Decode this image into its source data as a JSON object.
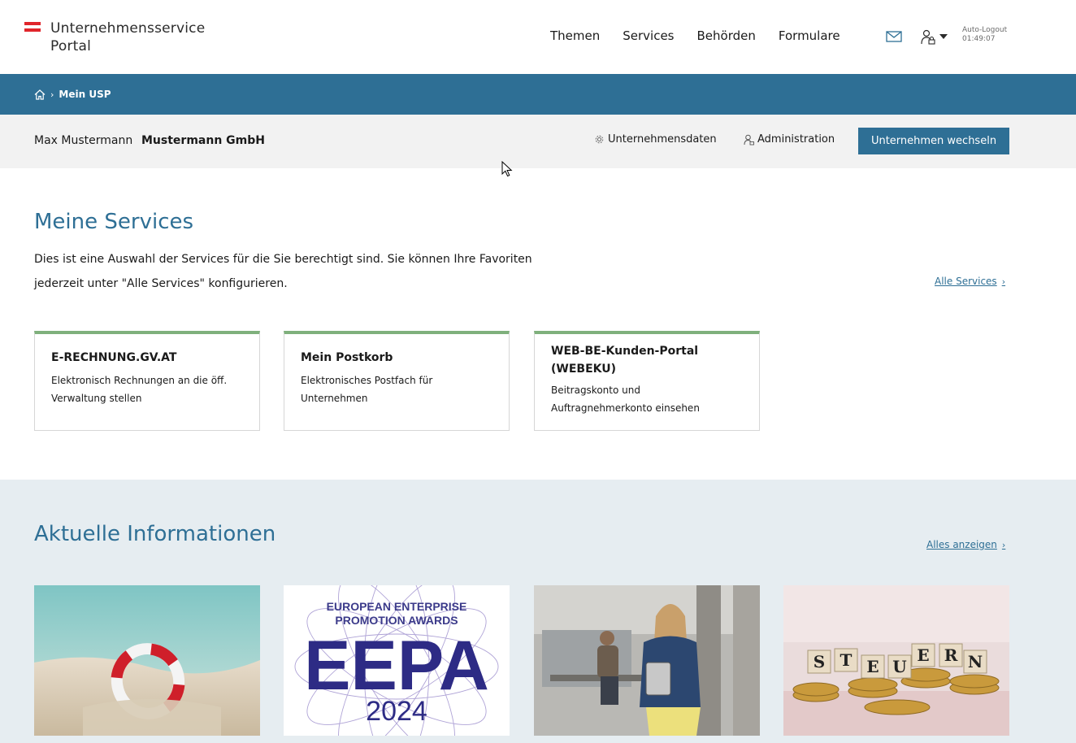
{
  "header": {
    "logo_line1": "Unternehmensservice",
    "logo_line2": "Portal",
    "nav": [
      "Themen",
      "Services",
      "Behörden",
      "Formulare"
    ],
    "mail_icon": "mail-icon",
    "user_icon": "user-lock-icon",
    "logout_label": "Auto-Logout",
    "logout_time": "01:49:07",
    "flag_colors": [
      "#e0252b",
      "#ffffff",
      "#e0252b"
    ]
  },
  "breadcrumb": {
    "home_icon": "home-icon",
    "current": "Mein USP"
  },
  "account": {
    "user": "Max Mustermann",
    "company": "Mustermann GmbH",
    "company_data_label": "Unternehmensdaten",
    "admin_label": "Administration",
    "switch_button": "Unternehmen wechseln"
  },
  "services": {
    "title": "Meine Services",
    "description": "Dies ist eine Auswahl der Services für die Sie berechtigt sind. Sie können Ihre Favoriten jederzeit unter \"Alle Services\" konfigurieren.",
    "all_link": "Alle Services",
    "cards": [
      {
        "title": "E-RECHNUNG.GV.AT",
        "desc": "Elektronisch Rechnungen an die öff. Verwaltung stellen"
      },
      {
        "title": "Mein Postkorb",
        "desc": "Elektronisches Postfach für Unternehmen"
      },
      {
        "title": "WEB-BE-Kunden-Portal (WEBEKU)",
        "desc": "Beitragskonto und Auftragnehmerkonto einsehen"
      }
    ]
  },
  "info": {
    "title": "Aktuelle Informationen",
    "all_link": "Alles anzeigen",
    "eepa_line1": "EUROPEAN ENTERPRISE",
    "eepa_line2": "PROMOTION AWARDS",
    "eepa_big": "EEPA",
    "eepa_year": "2024",
    "steuern_letters": [
      "S",
      "T",
      "E",
      "U",
      "E",
      "R",
      "N"
    ]
  },
  "colors": {
    "primary": "#2e6f95",
    "card_accent": "#7fb07c",
    "info_bg": "#e6edf1"
  }
}
